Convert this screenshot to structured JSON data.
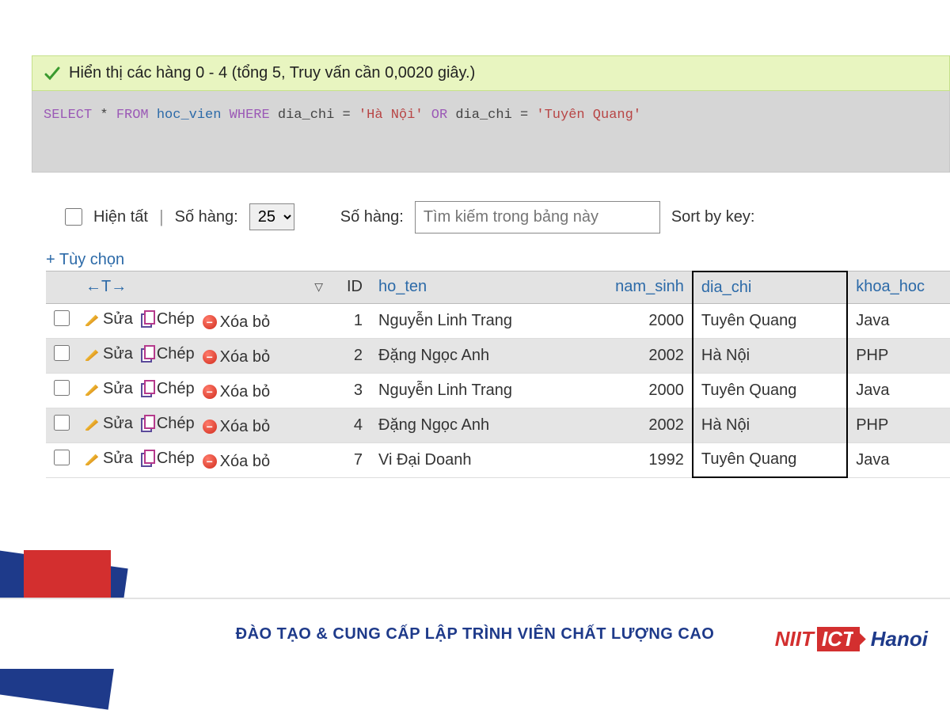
{
  "success": {
    "text": "Hiển thị các hàng 0 - 4 (tổng 5, Truy vấn cần 0,0020 giây.)"
  },
  "sql": {
    "select": "SELECT",
    "star": "*",
    "from": "FROM",
    "table": "hoc_vien",
    "where": "WHERE",
    "col1": "dia_chi",
    "eq": "=",
    "val1": "'Hà Nội'",
    "or": "OR",
    "col2": "dia_chi",
    "val2": "'Tuyên Quang'"
  },
  "controls": {
    "show_all_label": "Hiện tất",
    "rows_label_1": "Số hàng:",
    "rows_value": "25",
    "rows_label_2": "Số hàng:",
    "search_placeholder": "Tìm kiếm trong bảng này",
    "sort_label": "Sort by key:"
  },
  "options_link": "+ Tùy chọn",
  "table": {
    "headers": {
      "t_arrow": "←T→",
      "id": "ID",
      "ho_ten": "ho_ten",
      "nam_sinh": "nam_sinh",
      "dia_chi": "dia_chi",
      "khoa_hoc": "khoa_hoc"
    },
    "actions": {
      "edit": "Sửa",
      "copy": "Chép",
      "delete": "Xóa bỏ"
    },
    "rows": [
      {
        "id": "1",
        "ho_ten": "Nguyễn Linh Trang",
        "nam_sinh": "2000",
        "dia_chi": "Tuyên Quang",
        "khoa_hoc": "Java"
      },
      {
        "id": "2",
        "ho_ten": "Đặng Ngọc Anh",
        "nam_sinh": "2002",
        "dia_chi": "Hà Nội",
        "khoa_hoc": "PHP"
      },
      {
        "id": "3",
        "ho_ten": "Nguyễn Linh Trang",
        "nam_sinh": "2000",
        "dia_chi": "Tuyên Quang",
        "khoa_hoc": "Java"
      },
      {
        "id": "4",
        "ho_ten": "Đặng Ngọc Anh",
        "nam_sinh": "2002",
        "dia_chi": "Hà Nội",
        "khoa_hoc": "PHP"
      },
      {
        "id": "7",
        "ho_ten": "Vi Đại Doanh",
        "nam_sinh": "1992",
        "dia_chi": "Tuyên Quang",
        "khoa_hoc": "Java"
      }
    ]
  },
  "footer": {
    "text": "ĐÀO TẠO & CUNG CẤP LẬP TRÌNH VIÊN CHẤT LƯỢNG CAO",
    "logo_niit": "NIIT",
    "logo_ict": "ICT",
    "logo_hanoi": "Hanoi"
  }
}
